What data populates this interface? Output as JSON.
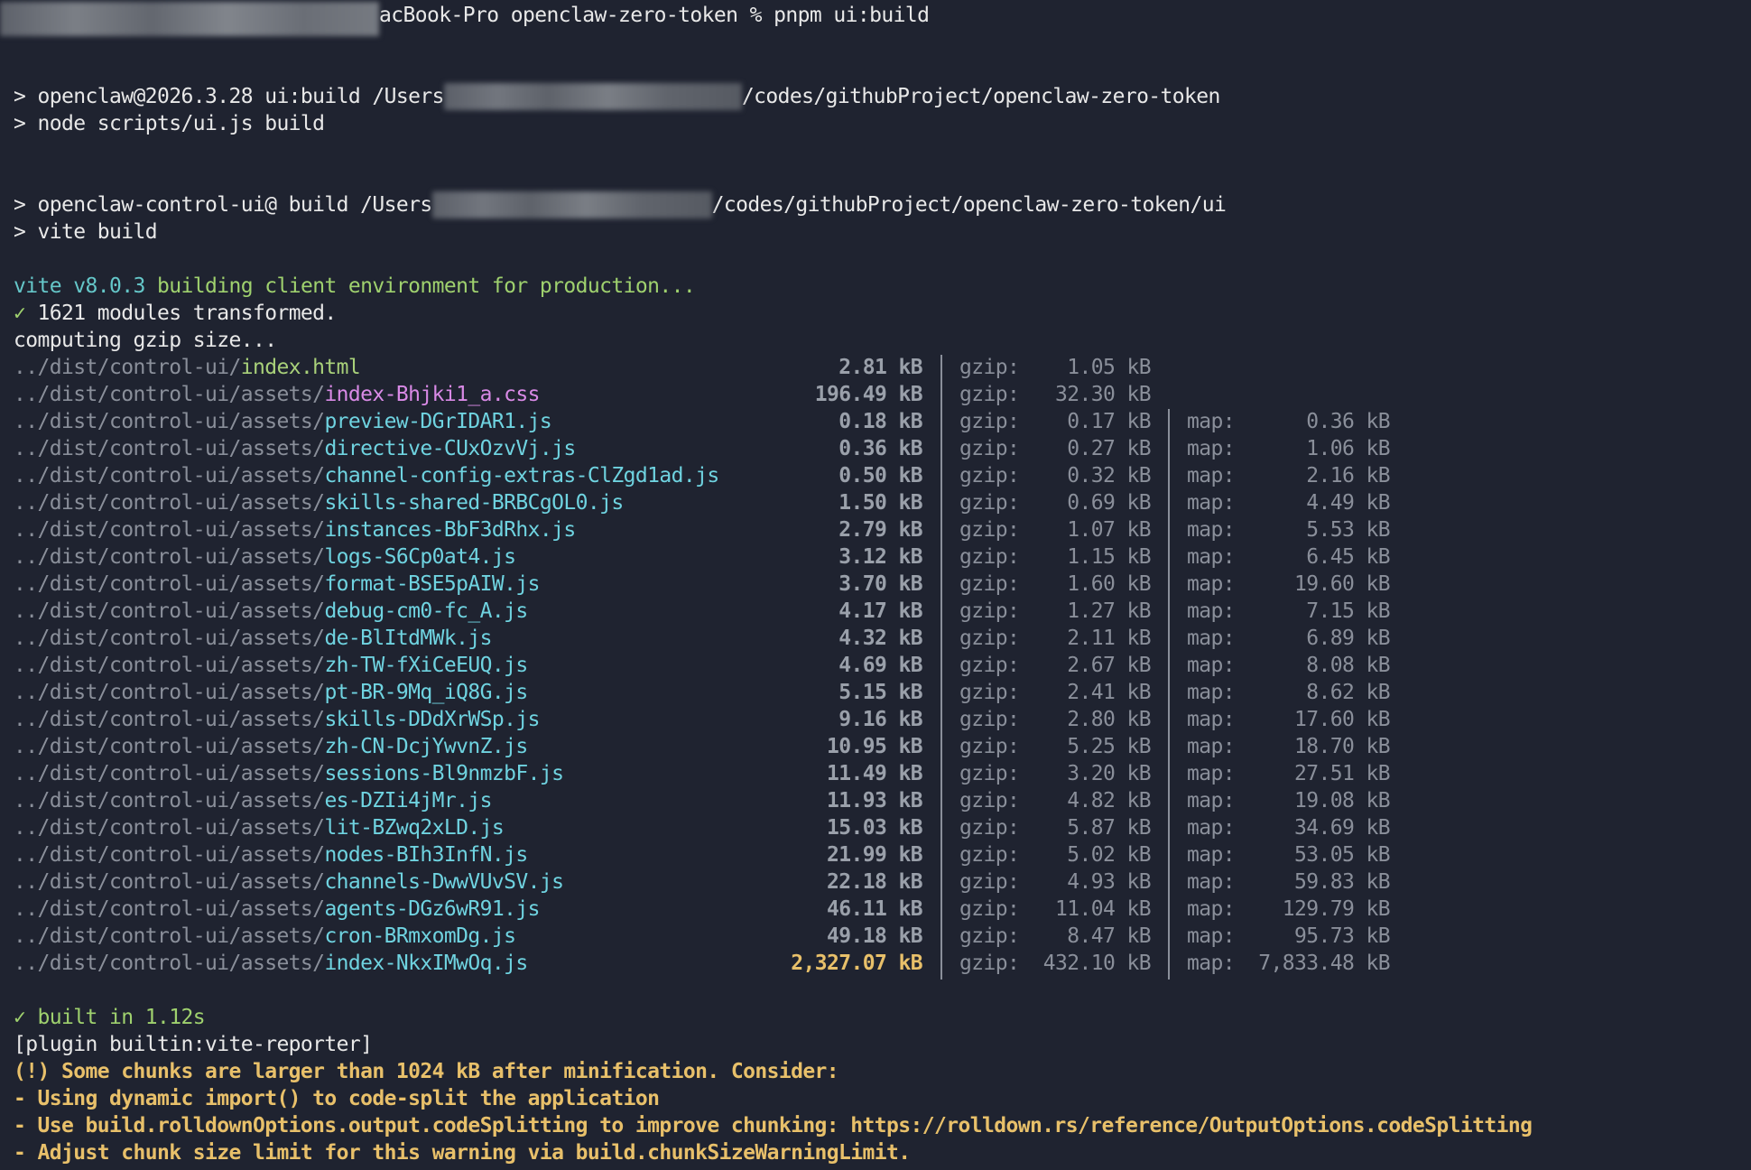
{
  "terminal": {
    "prompt_line": "acBook-Pro openclaw-zero-token % pnpm ui:build",
    "run1_a_prefix": "> openclaw@2026.3.28 ui:build /Users",
    "run1_a_suffix": "/codes/githubProject/openclaw-zero-token",
    "run1_b": "> node scripts/ui.js build",
    "run2_a_prefix": "> openclaw-control-ui@ build /Users",
    "run2_a_suffix": "/codes/githubProject/openclaw-zero-token/ui",
    "run2_b": "> vite build",
    "vite_version": "vite v8.0.3",
    "vite_building": " building client environment for production...",
    "check_mark": "✓",
    "modules": " 1621 modules transformed.",
    "computing": "computing gzip size...",
    "dir_prefix_root": "../dist/control-ui/",
    "dir_prefix_assets": "../dist/control-ui/assets/",
    "gzip_label": "gzip:",
    "map_label": "map:",
    "files": [
      {
        "dir": "../dist/control-ui/",
        "name": "index.html",
        "kind": "html",
        "size": "2.81 kB",
        "gzip": "1.05 kB",
        "map": ""
      },
      {
        "dir": "../dist/control-ui/assets/",
        "name": "index-Bhjki1_a.css",
        "kind": "css",
        "size": "196.49 kB",
        "gzip": "32.30 kB",
        "map": ""
      },
      {
        "dir": "../dist/control-ui/assets/",
        "name": "preview-DGrIDAR1.js",
        "kind": "js",
        "size": "0.18 kB",
        "gzip": "0.17 kB",
        "map": "0.36 kB"
      },
      {
        "dir": "../dist/control-ui/assets/",
        "name": "directive-CUxOzvVj.js",
        "kind": "js",
        "size": "0.36 kB",
        "gzip": "0.27 kB",
        "map": "1.06 kB"
      },
      {
        "dir": "../dist/control-ui/assets/",
        "name": "channel-config-extras-ClZgd1ad.js",
        "kind": "js",
        "size": "0.50 kB",
        "gzip": "0.32 kB",
        "map": "2.16 kB"
      },
      {
        "dir": "../dist/control-ui/assets/",
        "name": "skills-shared-BRBCgOL0.js",
        "kind": "js",
        "size": "1.50 kB",
        "gzip": "0.69 kB",
        "map": "4.49 kB"
      },
      {
        "dir": "../dist/control-ui/assets/",
        "name": "instances-BbF3dRhx.js",
        "kind": "js",
        "size": "2.79 kB",
        "gzip": "1.07 kB",
        "map": "5.53 kB"
      },
      {
        "dir": "../dist/control-ui/assets/",
        "name": "logs-S6Cp0at4.js",
        "kind": "js",
        "size": "3.12 kB",
        "gzip": "1.15 kB",
        "map": "6.45 kB"
      },
      {
        "dir": "../dist/control-ui/assets/",
        "name": "format-BSE5pAIW.js",
        "kind": "js",
        "size": "3.70 kB",
        "gzip": "1.60 kB",
        "map": "19.60 kB"
      },
      {
        "dir": "../dist/control-ui/assets/",
        "name": "debug-cm0-fc_A.js",
        "kind": "js",
        "size": "4.17 kB",
        "gzip": "1.27 kB",
        "map": "7.15 kB"
      },
      {
        "dir": "../dist/control-ui/assets/",
        "name": "de-BlItdMWk.js",
        "kind": "js",
        "size": "4.32 kB",
        "gzip": "2.11 kB",
        "map": "6.89 kB"
      },
      {
        "dir": "../dist/control-ui/assets/",
        "name": "zh-TW-fXiCeEUQ.js",
        "kind": "js",
        "size": "4.69 kB",
        "gzip": "2.67 kB",
        "map": "8.08 kB"
      },
      {
        "dir": "../dist/control-ui/assets/",
        "name": "pt-BR-9Mq_iQ8G.js",
        "kind": "js",
        "size": "5.15 kB",
        "gzip": "2.41 kB",
        "map": "8.62 kB"
      },
      {
        "dir": "../dist/control-ui/assets/",
        "name": "skills-DDdXrWSp.js",
        "kind": "js",
        "size": "9.16 kB",
        "gzip": "2.80 kB",
        "map": "17.60 kB"
      },
      {
        "dir": "../dist/control-ui/assets/",
        "name": "zh-CN-DcjYwvnZ.js",
        "kind": "js",
        "size": "10.95 kB",
        "gzip": "5.25 kB",
        "map": "18.70 kB"
      },
      {
        "dir": "../dist/control-ui/assets/",
        "name": "sessions-Bl9nmzbF.js",
        "kind": "js",
        "size": "11.49 kB",
        "gzip": "3.20 kB",
        "map": "27.51 kB"
      },
      {
        "dir": "../dist/control-ui/assets/",
        "name": "es-DZIi4jMr.js",
        "kind": "js",
        "size": "11.93 kB",
        "gzip": "4.82 kB",
        "map": "19.08 kB"
      },
      {
        "dir": "../dist/control-ui/assets/",
        "name": "lit-BZwq2xLD.js",
        "kind": "js",
        "size": "15.03 kB",
        "gzip": "5.87 kB",
        "map": "34.69 kB"
      },
      {
        "dir": "../dist/control-ui/assets/",
        "name": "nodes-BIh3InfN.js",
        "kind": "js",
        "size": "21.99 kB",
        "gzip": "5.02 kB",
        "map": "53.05 kB"
      },
      {
        "dir": "../dist/control-ui/assets/",
        "name": "channels-DwwVUvSV.js",
        "kind": "js",
        "size": "22.18 kB",
        "gzip": "4.93 kB",
        "map": "59.83 kB"
      },
      {
        "dir": "../dist/control-ui/assets/",
        "name": "agents-DGz6wR91.js",
        "kind": "js",
        "size": "46.11 kB",
        "gzip": "11.04 kB",
        "map": "129.79 kB"
      },
      {
        "dir": "../dist/control-ui/assets/",
        "name": "cron-BRmxomDg.js",
        "kind": "js",
        "size": "49.18 kB",
        "gzip": "8.47 kB",
        "map": "95.73 kB"
      },
      {
        "dir": "../dist/control-ui/assets/",
        "name": "index-NkxIMwOq.js",
        "kind": "js",
        "size": "2,327.07 kB",
        "gzip": "432.10 kB",
        "map": "7,833.48 kB",
        "large": true
      }
    ],
    "built": " built in 1.12s",
    "plugin": "[plugin builtin:vite-reporter]",
    "warn_lines": [
      "(!) Some chunks are larger than 1024 kB after minification. Consider:",
      "- Using dynamic import() to code-split the application",
      "- Use build.rolldownOptions.output.codeSplitting to improve chunking: https://rolldown.rs/reference/OutputOptions.codeSplitting",
      "- Adjust chunk size limit for this warning via build.chunkSizeWarningLimit."
    ]
  },
  "colors": {
    "background": "#1f2330",
    "vite_accent": "#65c7c9",
    "success": "#9fd16e",
    "js_file": "#6fd3e0",
    "css_file": "#d98ae6",
    "warning": "#e8c06a"
  }
}
